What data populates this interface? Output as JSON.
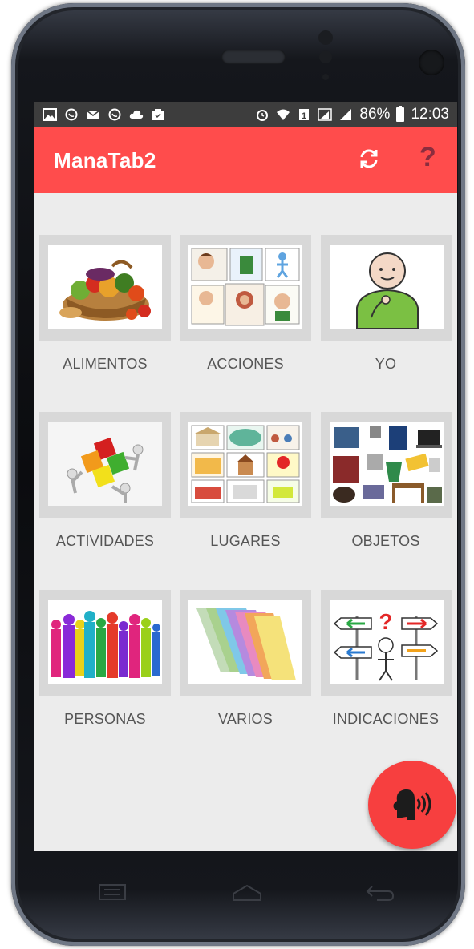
{
  "status_bar": {
    "notification_icons": [
      "image-icon",
      "whatsapp-icon",
      "mail-icon",
      "whatsapp-icon",
      "cloud-icon",
      "bag-icon",
      "alarm-icon",
      "wifi-icon",
      "sim-icon",
      "signal-icon",
      "signal-icon"
    ],
    "battery_text": "86%",
    "time": "12:03"
  },
  "app_bar": {
    "title": "ManaTab2",
    "refresh_icon": "refresh-icon",
    "help_icon": "?",
    "color": "#ff4c4c",
    "help_color": "#8b2d3e"
  },
  "categories": [
    {
      "label": "ALIMENTOS",
      "image": "food-basket"
    },
    {
      "label": "ACCIONES",
      "image": "actions-pictograms"
    },
    {
      "label": "YO",
      "image": "person-pointing-self"
    },
    {
      "label": "ACTIVIDADES",
      "image": "puzzle-people"
    },
    {
      "label": "LUGARES",
      "image": "places-pictograms"
    },
    {
      "label": "OBJETOS",
      "image": "objects-collage"
    },
    {
      "label": "PERSONAS",
      "image": "people-silhouettes"
    },
    {
      "label": "VARIOS",
      "image": "colored-folders"
    },
    {
      "label": "INDICACIONES",
      "image": "signpost-arrows"
    }
  ],
  "fab": {
    "icon": "speaking-head-icon",
    "color": "#f73f3f"
  },
  "nav_bar": {
    "icons": [
      "recent-apps-icon",
      "home-icon",
      "back-icon"
    ]
  }
}
